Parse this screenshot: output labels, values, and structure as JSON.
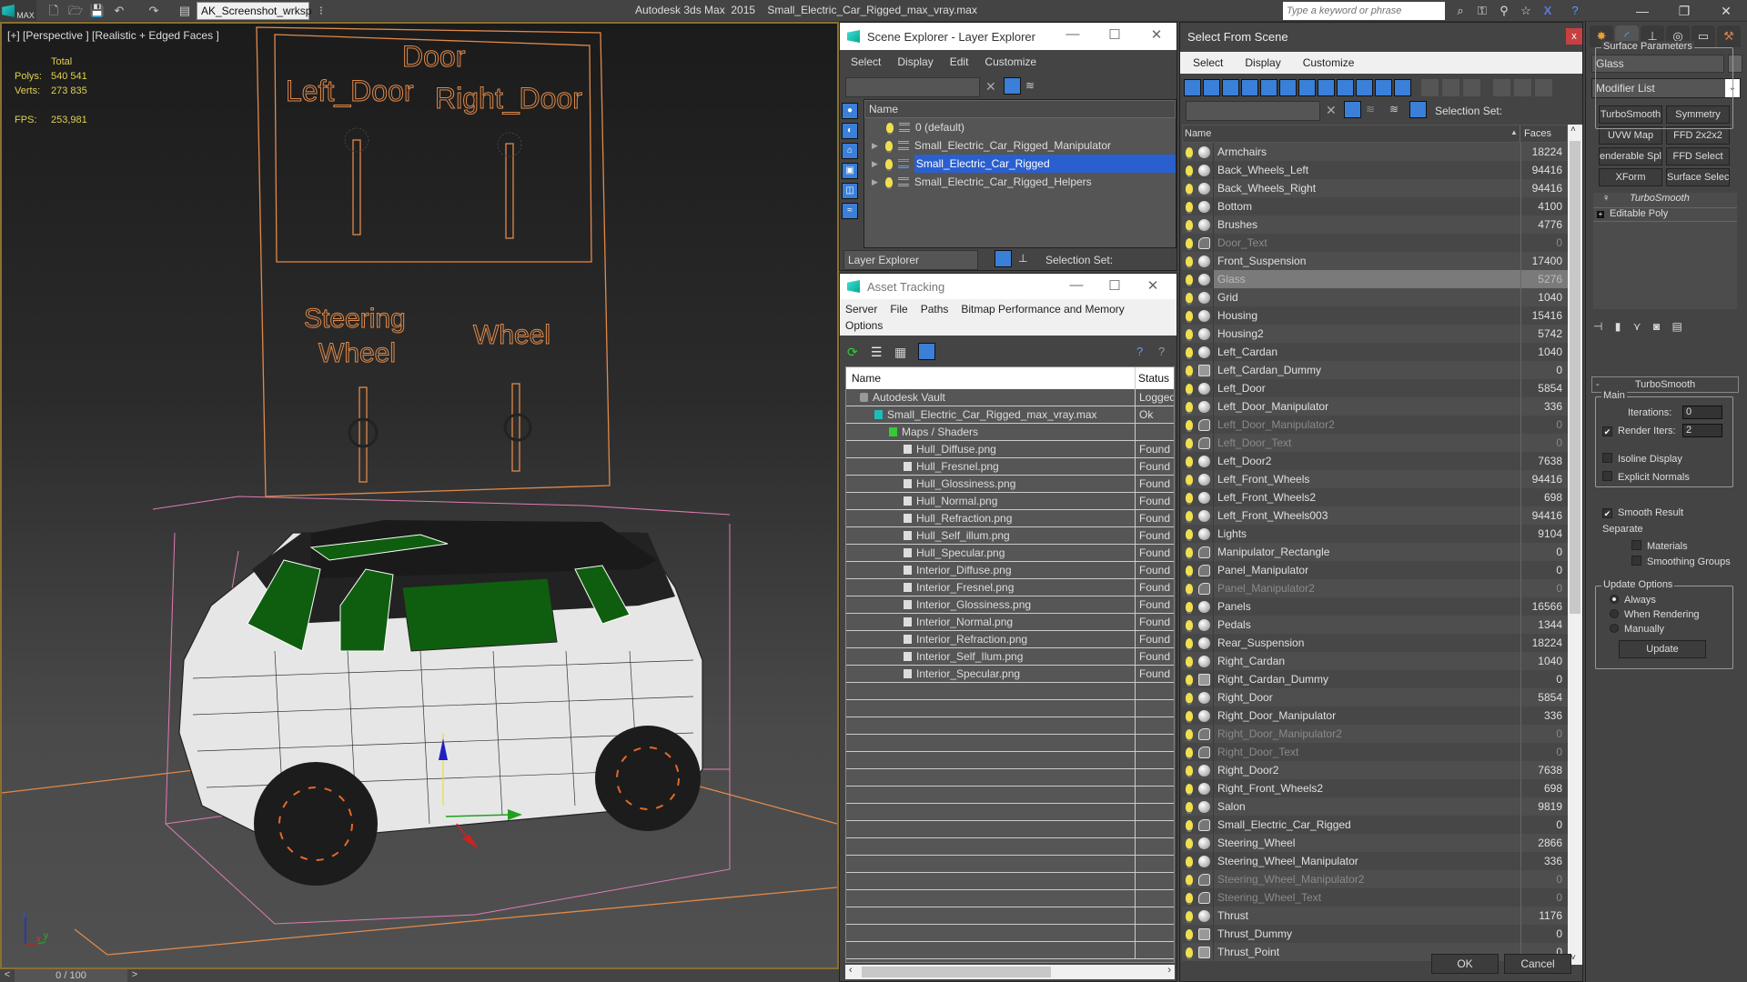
{
  "app": {
    "logo_label": "MAX",
    "workspace": "AK_Screenshot_wrksp",
    "title": "Autodesk 3ds Max  2015    Small_Electric_Car_Rigged_max_vray.max",
    "search_placeholder": "Type a keyword or phrase"
  },
  "viewport": {
    "label": "[+] [Perspective ] [Realistic + Edged Faces ]",
    "stats": {
      "total_label": "Total",
      "polys_label": "Polys:",
      "polys_value": "540 541",
      "verts_label": "Verts:",
      "verts_value": "273 835",
      "fps_label": "FPS:",
      "fps_value": "253,981"
    },
    "scene_text": {
      "door": "Door",
      "left_door": "Left_Door",
      "right_door": "Right_Door",
      "steering": "Steering",
      "steering_wheel": "Wheel",
      "wheel": "Wheel"
    },
    "axis": {
      "z": "z",
      "x": "x",
      "y": "y"
    }
  },
  "timeline": {
    "prev": "<",
    "frame": "0 / 100",
    "next": ">"
  },
  "scene_explorer": {
    "title": "Scene Explorer - Layer Explorer",
    "menu": [
      "Select",
      "Display",
      "Edit",
      "Customize"
    ],
    "column_name": "Name",
    "layers": [
      {
        "name": "0 (default)",
        "expandable": false,
        "selected": false
      },
      {
        "name": "Small_Electric_Car_Rigged_Manipulator",
        "expandable": true,
        "selected": false
      },
      {
        "name": "Small_Electric_Car_Rigged",
        "expandable": true,
        "selected": true
      },
      {
        "name": "Small_Electric_Car_Rigged_Helpers",
        "expandable": true,
        "selected": false
      }
    ],
    "explorer_type": "Layer Explorer",
    "selection_set_label": "Selection Set:"
  },
  "asset_tracking": {
    "title": "Asset Tracking",
    "menu": [
      "Server",
      "File",
      "Paths",
      "Bitmap Performance and Memory",
      "Options"
    ],
    "col_name": "Name",
    "col_status": "Status",
    "rows": [
      {
        "name": "Autodesk Vault",
        "status": "Logged",
        "indent": 0,
        "icon": "vault-icon"
      },
      {
        "name": "Small_Electric_Car_Rigged_max_vray.max",
        "status": "Ok",
        "indent": 1,
        "icon": "max-file-icon"
      },
      {
        "name": "Maps / Shaders",
        "status": "",
        "indent": 2,
        "icon": "maps-icon"
      },
      {
        "name": "Hull_Diffuse.png",
        "status": "Found",
        "indent": 3,
        "icon": "bitmap-icon"
      },
      {
        "name": "Hull_Fresnel.png",
        "status": "Found",
        "indent": 3,
        "icon": "bitmap-icon"
      },
      {
        "name": "Hull_Glossiness.png",
        "status": "Found",
        "indent": 3,
        "icon": "bitmap-icon"
      },
      {
        "name": "Hull_Normal.png",
        "status": "Found",
        "indent": 3,
        "icon": "bitmap-icon"
      },
      {
        "name": "Hull_Refraction.png",
        "status": "Found",
        "indent": 3,
        "icon": "bitmap-icon"
      },
      {
        "name": "Hull_Self_illum.png",
        "status": "Found",
        "indent": 3,
        "icon": "bitmap-icon"
      },
      {
        "name": "Hull_Specular.png",
        "status": "Found",
        "indent": 3,
        "icon": "bitmap-icon"
      },
      {
        "name": "Interior_Diffuse.png",
        "status": "Found",
        "indent": 3,
        "icon": "bitmap-icon"
      },
      {
        "name": "Interior_Fresnel.png",
        "status": "Found",
        "indent": 3,
        "icon": "bitmap-icon"
      },
      {
        "name": "Interior_Glossiness.png",
        "status": "Found",
        "indent": 3,
        "icon": "bitmap-icon"
      },
      {
        "name": "Interior_Normal.png",
        "status": "Found",
        "indent": 3,
        "icon": "bitmap-icon"
      },
      {
        "name": "Interior_Refraction.png",
        "status": "Found",
        "indent": 3,
        "icon": "bitmap-icon"
      },
      {
        "name": "Interior_Self_Ilum.png",
        "status": "Found",
        "indent": 3,
        "icon": "bitmap-icon"
      },
      {
        "name": "Interior_Specular.png",
        "status": "Found",
        "indent": 3,
        "icon": "bitmap-icon"
      }
    ]
  },
  "select_from_scene": {
    "title": "Select From Scene",
    "close": "x",
    "menu": [
      "Select",
      "Display",
      "Customize"
    ],
    "selection_set_label": "Selection Set:",
    "col_name": "Name",
    "col_faces": "Faces",
    "ok_label": "OK",
    "cancel_label": "Cancel",
    "objects": [
      {
        "name": "Armchairs",
        "faces": "18224",
        "type": "geometry",
        "dim": false
      },
      {
        "name": "Back_Wheels_Left",
        "faces": "94416",
        "type": "geometry",
        "dim": false
      },
      {
        "name": "Back_Wheels_Right",
        "faces": "94416",
        "type": "geometry",
        "dim": false
      },
      {
        "name": "Bottom",
        "faces": "4100",
        "type": "geometry",
        "dim": false
      },
      {
        "name": "Brushes",
        "faces": "4776",
        "type": "geometry",
        "dim": false
      },
      {
        "name": "Door_Text",
        "faces": "0",
        "type": "shape",
        "dim": true
      },
      {
        "name": "Front_Suspension",
        "faces": "17400",
        "type": "geometry",
        "dim": false
      },
      {
        "name": "Glass",
        "faces": "5276",
        "type": "geometry",
        "dim": false,
        "selected": true
      },
      {
        "name": "Grid",
        "faces": "1040",
        "type": "geometry",
        "dim": false
      },
      {
        "name": "Housing",
        "faces": "15416",
        "type": "geometry",
        "dim": false
      },
      {
        "name": "Housing2",
        "faces": "5742",
        "type": "geometry",
        "dim": false
      },
      {
        "name": "Left_Cardan",
        "faces": "1040",
        "type": "geometry",
        "dim": false
      },
      {
        "name": "Left_Cardan_Dummy",
        "faces": "0",
        "type": "helper",
        "dim": false
      },
      {
        "name": "Left_Door",
        "faces": "5854",
        "type": "geometry",
        "dim": false
      },
      {
        "name": "Left_Door_Manipulator",
        "faces": "336",
        "type": "geometry",
        "dim": false
      },
      {
        "name": "Left_Door_Manipulator2",
        "faces": "0",
        "type": "shape",
        "dim": true
      },
      {
        "name": "Left_Door_Text",
        "faces": "0",
        "type": "shape",
        "dim": true
      },
      {
        "name": "Left_Door2",
        "faces": "7638",
        "type": "geometry",
        "dim": false
      },
      {
        "name": "Left_Front_Wheels",
        "faces": "94416",
        "type": "geometry",
        "dim": false
      },
      {
        "name": "Left_Front_Wheels2",
        "faces": "698",
        "type": "geometry",
        "dim": false
      },
      {
        "name": "Left_Front_Wheels003",
        "faces": "94416",
        "type": "geometry",
        "dim": false
      },
      {
        "name": "Lights",
        "faces": "9104",
        "type": "geometry",
        "dim": false
      },
      {
        "name": "Manipulator_Rectangle",
        "faces": "0",
        "type": "shape",
        "dim": false
      },
      {
        "name": "Panel_Manipulator",
        "faces": "0",
        "type": "shape",
        "dim": false
      },
      {
        "name": "Panel_Manipulator2",
        "faces": "0",
        "type": "shape",
        "dim": true
      },
      {
        "name": "Panels",
        "faces": "16566",
        "type": "geometry",
        "dim": false
      },
      {
        "name": "Pedals",
        "faces": "1344",
        "type": "geometry",
        "dim": false
      },
      {
        "name": "Rear_Suspension",
        "faces": "18224",
        "type": "geometry",
        "dim": false
      },
      {
        "name": "Right_Cardan",
        "faces": "1040",
        "type": "geometry",
        "dim": false
      },
      {
        "name": "Right_Cardan_Dummy",
        "faces": "0",
        "type": "helper",
        "dim": false
      },
      {
        "name": "Right_Door",
        "faces": "5854",
        "type": "geometry",
        "dim": false
      },
      {
        "name": "Right_Door_Manipulator",
        "faces": "336",
        "type": "geometry",
        "dim": false
      },
      {
        "name": "Right_Door_Manipulator2",
        "faces": "0",
        "type": "shape",
        "dim": true
      },
      {
        "name": "Right_Door_Text",
        "faces": "0",
        "type": "shape",
        "dim": true
      },
      {
        "name": "Right_Door2",
        "faces": "7638",
        "type": "geometry",
        "dim": false
      },
      {
        "name": "Right_Front_Wheels2",
        "faces": "698",
        "type": "geometry",
        "dim": false
      },
      {
        "name": "Salon",
        "faces": "9819",
        "type": "geometry",
        "dim": false
      },
      {
        "name": "Small_Electric_Car_Rigged",
        "faces": "0",
        "type": "group",
        "dim": false
      },
      {
        "name": "Steering_Wheel",
        "faces": "2866",
        "type": "geometry",
        "dim": false
      },
      {
        "name": "Steering_Wheel_Manipulator",
        "faces": "336",
        "type": "geometry",
        "dim": false
      },
      {
        "name": "Steering_Wheel_Manipulator2",
        "faces": "0",
        "type": "shape",
        "dim": true
      },
      {
        "name": "Steering_Wheel_Text",
        "faces": "0",
        "type": "shape",
        "dim": true
      },
      {
        "name": "Thrust",
        "faces": "1176",
        "type": "geometry",
        "dim": false
      },
      {
        "name": "Thrust_Dummy",
        "faces": "0",
        "type": "helper",
        "dim": false
      },
      {
        "name": "Thrust_Point",
        "faces": "0",
        "type": "helper",
        "dim": false
      }
    ]
  },
  "command_panel": {
    "object_name": "Glass",
    "modifier_list": "Modifier List",
    "modifier_buttons": [
      "TurboSmooth",
      "Symmetry",
      "UVW Map",
      "FFD 2x2x2",
      "enderable Splin",
      "FFD Select",
      "XForm",
      "Surface Select"
    ],
    "stack": [
      "TurboSmooth",
      "Editable Poly"
    ],
    "rollout": {
      "title": "TurboSmooth",
      "collapse": "-",
      "main_label": "Main",
      "iterations_label": "Iterations:",
      "iterations_value": "0",
      "render_iters_label": "Render Iters:",
      "render_iters_value": "2",
      "render_iters_checked": true,
      "isoline_label": "Isoline Display",
      "isoline_checked": false,
      "explicit_normals_label": "Explicit Normals",
      "explicit_normals_checked": false,
      "surface_label": "Surface Parameters",
      "smooth_result_label": "Smooth Result",
      "smooth_result_checked": true,
      "separate_label": "Separate",
      "materials_label": "Materials",
      "smoothing_groups_label": "Smoothing Groups",
      "update_label": "Update Options",
      "update_options": [
        "Always",
        "When Rendering",
        "Manually"
      ],
      "update_selected": "Always",
      "update_button": "Update"
    }
  }
}
